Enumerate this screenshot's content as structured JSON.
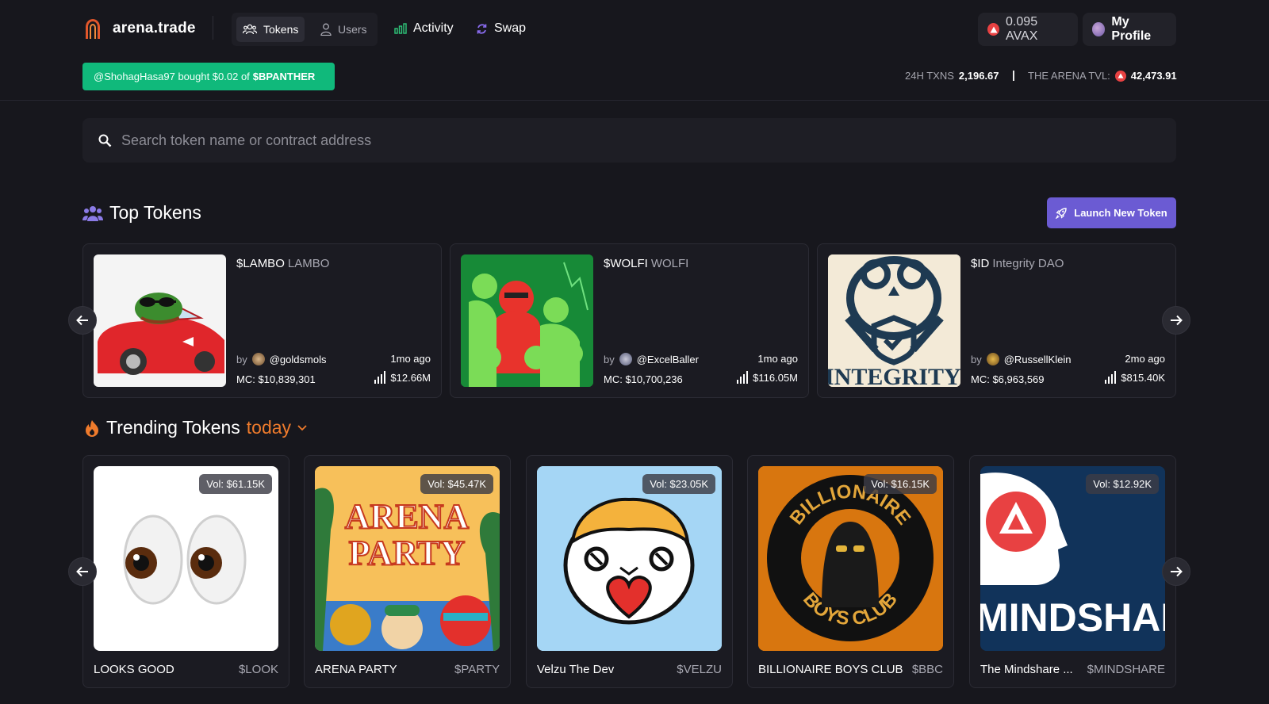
{
  "brand": {
    "name": "arena.trade"
  },
  "nav": {
    "tokens": "Tokens",
    "users": "Users",
    "activity": "Activity",
    "swap": "Swap"
  },
  "wallet": {
    "balance": "0.095 AVAX",
    "profile": "My Profile"
  },
  "ticker": {
    "text": "@ShohagHasa97 bought $0.02 of",
    "token": "$BPANTHER"
  },
  "stats": {
    "txns_label": "24H TXNS",
    "txns_value": "2,196.67",
    "sep": "|",
    "tvl_label": "THE ARENA TVL:",
    "tvl_value": "42,473.91"
  },
  "search": {
    "placeholder": "Search token name or contract address"
  },
  "top_tokens": {
    "title": "Top Tokens",
    "launch_label": "Launch New Token",
    "items": [
      {
        "symbol": "$LAMBO",
        "name": "LAMBO",
        "by": "by",
        "handle": "@goldsmols",
        "age": "1mo ago",
        "mc": "MC: $10,839,301",
        "volume": "$12.66M"
      },
      {
        "symbol": "$WOLFI",
        "name": "WOLFI",
        "by": "by",
        "handle": "@ExcelBaller",
        "age": "1mo ago",
        "mc": "MC: $10,700,236",
        "volume": "$116.05M"
      },
      {
        "symbol": "$ID",
        "name": "Integrity DAO",
        "by": "by",
        "handle": "@RussellKlein",
        "age": "2mo ago",
        "mc": "MC: $6,963,569",
        "volume": "$815.40K",
        "image_text": "INTEGRITY"
      }
    ]
  },
  "trending": {
    "title": "Trending Tokens",
    "period": "today",
    "items": [
      {
        "name": "LOOKS GOOD",
        "symbol": "$LOOK",
        "vol": "Vol: $61.15K"
      },
      {
        "name": "ARENA PARTY",
        "symbol": "$PARTY",
        "vol": "Vol: $45.47K",
        "image_text_1": "ARENA",
        "image_text_2": "PARTY"
      },
      {
        "name": "Velzu The Dev",
        "symbol": "$VELZU",
        "vol": "Vol: $23.05K"
      },
      {
        "name": "BILLIONAIRE BOYS CLUB",
        "symbol": "$BBC",
        "vol": "Vol: $16.15K",
        "image_text_1": "BILLIONAIRE",
        "image_text_2": "BOYS CLUB"
      },
      {
        "name": "The Mindshare ...",
        "symbol": "$MINDSHARE",
        "vol": "Vol: $12.92K",
        "image_text": "MINDSHAR"
      }
    ]
  },
  "colors": {
    "accent": "#6b5bd3",
    "ticker": "#10b97b",
    "fire": "#ef7b2c",
    "avax": "#e84142"
  },
  "icons": [
    "arena-logo-icon",
    "users-group-icon",
    "user-icon",
    "chart-bar-icon",
    "swap-icon",
    "avax-icon",
    "search-icon",
    "rocket-icon",
    "fire-icon",
    "chevron-down-icon",
    "arrow-left-icon",
    "arrow-right-icon",
    "volume-bars-icon"
  ]
}
